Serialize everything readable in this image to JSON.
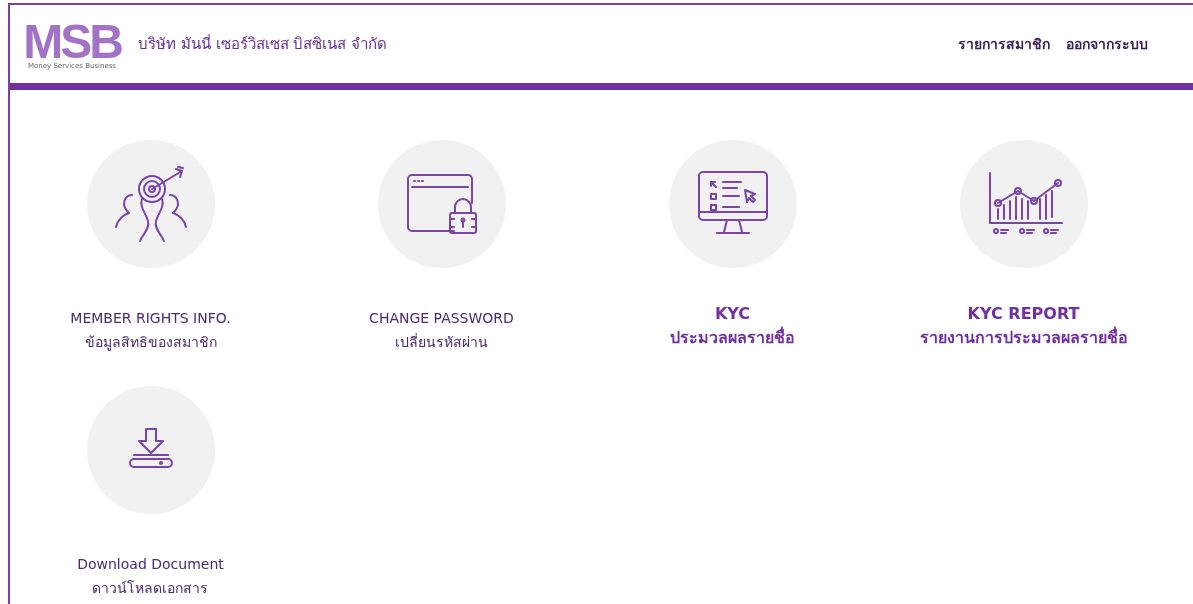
{
  "header": {
    "logo": {
      "letters": "MSB",
      "tagline": "Money Services Business"
    },
    "company_name": "บริษัท มันนี่ เซอร์วิสเซส บิสซิเนส จำกัด",
    "nav_links": [
      "รายการสมาชิก",
      "ออกจากระบบ"
    ]
  },
  "menu_tiles": [
    {
      "kind": "target",
      "highlighted": false,
      "title": "MEMBER RIGHTS INFO.",
      "subtitle": "ข้อมูลสิทธิของสมาชิก"
    },
    {
      "kind": "lock",
      "highlighted": false,
      "title": "CHANGE PASSWORD",
      "subtitle": "เปลี่ยนรหัสผ่าน"
    },
    {
      "kind": "monitor",
      "highlighted": true,
      "title": "KYC",
      "subtitle": "ประมวลผลรายชื่อ"
    },
    {
      "kind": "chart",
      "highlighted": true,
      "title": "KYC REPORT",
      "subtitle": "รายงานการประมวลผลรายชื่อ"
    },
    {
      "kind": "download",
      "highlighted": false,
      "title": "Download Document",
      "subtitle": "ดาวน์โหลดเอกสาร"
    }
  ]
}
